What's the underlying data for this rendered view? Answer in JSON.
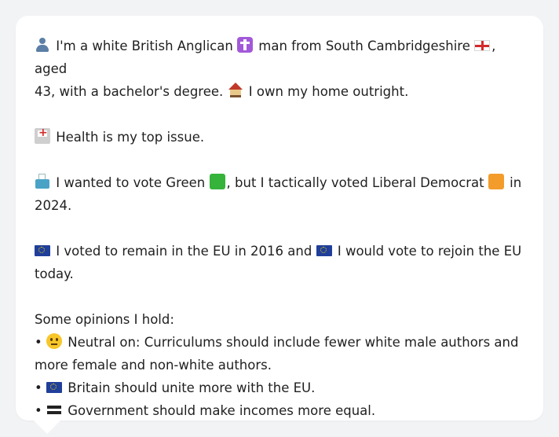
{
  "profile": {
    "intro_line1_a": "I'm a white British Anglican",
    "intro_line1_b": "man from South Cambridgeshire",
    "intro_line1_c": ", aged",
    "intro_line2_a": "43, with a bachelor's degree.",
    "intro_line2_b": "I own my home outright."
  },
  "health": {
    "text": "Health is my top issue."
  },
  "vote": {
    "line1_a": "I wanted to vote Green",
    "line1_b": ", but I tactically voted Liberal Democrat",
    "line1_c": "in",
    "line2": "2024."
  },
  "eu": {
    "line1_a": "I voted to remain in the EU in 2016 and",
    "line1_b": "I would vote to rejoin the EU",
    "line2": "today."
  },
  "opinions": {
    "heading": "Some opinions I hold:",
    "bullet": "•",
    "items": [
      {
        "icon": "neutral-face-icon",
        "line1": "Neutral on: Curriculums should include fewer white male authors and",
        "line2": "more female and non-white authors."
      },
      {
        "icon": "eu-flag-icon",
        "line1": "Britain should unite more with the EU."
      },
      {
        "icon": "equals-icon",
        "line1": "Government should make incomes more equal."
      }
    ]
  },
  "icons": {
    "person": "person-silhouette-icon",
    "cross": "latin-cross-icon",
    "england": "england-flag-icon",
    "house": "house-icon",
    "hospital": "hospital-icon",
    "ballot": "ballot-box-icon",
    "green": "green-square-icon",
    "orange": "orange-square-icon",
    "eu": "eu-flag-icon"
  },
  "colors": {
    "background": "#f2f3f5",
    "bubble": "#ffffff",
    "text": "#1f1f1f",
    "green_party": "#35b33a",
    "lib_dem": "#f39c2b"
  }
}
